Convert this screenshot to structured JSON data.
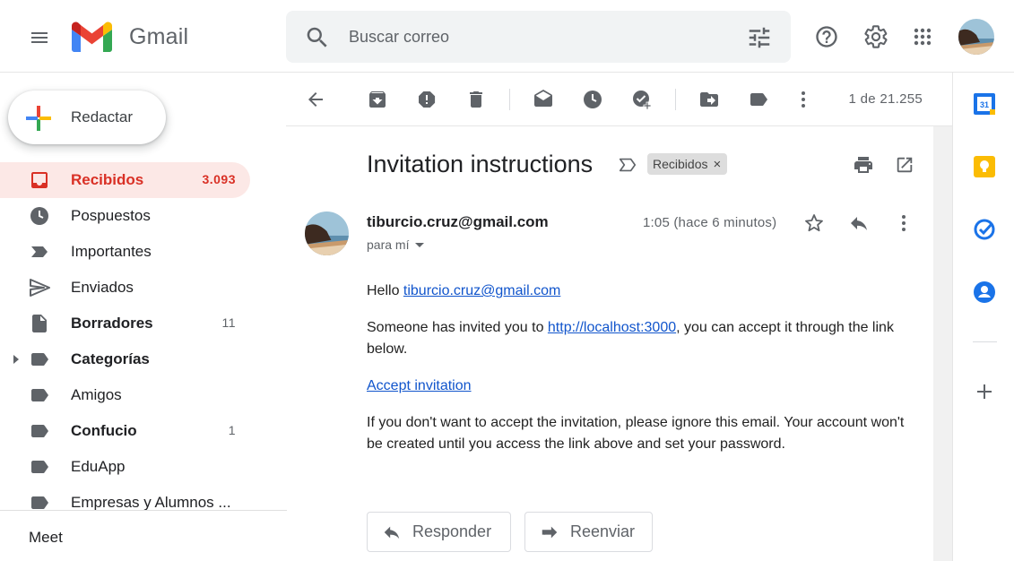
{
  "app": {
    "name": "Gmail"
  },
  "search": {
    "placeholder": "Buscar correo"
  },
  "compose": {
    "label": "Redactar"
  },
  "nav": {
    "items": [
      {
        "label": "Recibidos",
        "count": "3.093",
        "icon": "inbox-icon"
      },
      {
        "label": "Pospuestos",
        "count": "",
        "icon": "clock-icon"
      },
      {
        "label": "Importantes",
        "count": "",
        "icon": "important-icon"
      },
      {
        "label": "Enviados",
        "count": "",
        "icon": "send-icon"
      },
      {
        "label": "Borradores",
        "count": "11",
        "icon": "draft-icon"
      },
      {
        "label": "Categorías",
        "count": "",
        "icon": "label-icon"
      },
      {
        "label": "Amigos",
        "count": "",
        "icon": "label-icon"
      },
      {
        "label": "Confucio",
        "count": "1",
        "icon": "label-icon"
      },
      {
        "label": "EduApp",
        "count": "",
        "icon": "label-icon"
      },
      {
        "label": "Empresas y Alumnos ...",
        "count": "",
        "icon": "label-icon"
      }
    ],
    "meet": "Meet"
  },
  "toolbar": {
    "pager": "1 de 21.255"
  },
  "message": {
    "subject": "Invitation instructions",
    "label_chip": "Recibidos",
    "label_chip_remove": "×",
    "sender": "tiburcio.cruz@gmail.com",
    "recipient": "para mí",
    "time": "1:05 (hace 6 minutos)",
    "greeting": "Hello ",
    "greeting_link": "tiburcio.cruz@gmail.com",
    "invite_text": "Someone has invited you to ",
    "invite_link": "http://localhost:3000",
    "invite_text_after": ", you can accept it through the link below.",
    "accept_link": "Accept invitation",
    "ignore_text": "If you don't want to accept the invitation, please ignore this email. Your account won't be created until you access the link above and set your password."
  },
  "actions": {
    "reply": "Responder",
    "forward": "Reenviar"
  },
  "side_panel": {
    "calendar_day": "31"
  },
  "colors": {
    "accent_red": "#d93025",
    "active_bg": "#fce8e6",
    "link": "#1155cc",
    "calendar_blue": "#1a73e8",
    "keep_yellow": "#fbbc04"
  }
}
